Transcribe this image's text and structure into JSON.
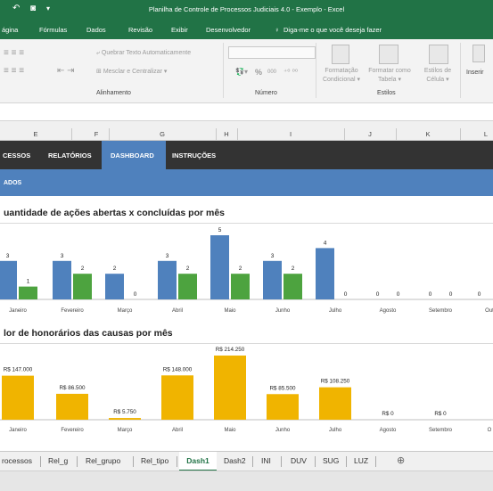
{
  "window": {
    "title": "Planilha de Controle de Processos Judiciais 4.0 - Exemplo  -  Excel"
  },
  "ribbon_tabs": [
    "ágina",
    "Fórmulas",
    "Dados",
    "Revisão",
    "Exibir",
    "Desenvolvedor"
  ],
  "tell_me": "Diga-me o que você deseja fazer",
  "ribbon": {
    "wrap_text": "Quebrar Texto Automaticamente",
    "merge_center": "Mesclar e Centralizar",
    "group_alignment": "Alinhamento",
    "group_number": "Número",
    "group_styles": "Estilos",
    "number_percent": "%",
    "number_thousands": "000",
    "cond_format_1": "Formatação",
    "cond_format_2": "Condicional",
    "format_table_1": "Formatar como",
    "format_table_2": "Tabela",
    "cell_styles_1": "Estilos de",
    "cell_styles_2": "Célula",
    "insert": "Inserir"
  },
  "columns": [
    "E",
    "F",
    "G",
    "H",
    "I",
    "J",
    "K",
    "L"
  ],
  "menu": {
    "items": [
      "CESSOS",
      "RELATÓRIOS",
      "DASHBOARD",
      "INSTRUÇÕES"
    ],
    "active": "DASHBOARD"
  },
  "subheader": "ADOS",
  "chart_data": [
    {
      "type": "bar",
      "title": "uantidade de ações abertas x concluídas por mês",
      "categories": [
        "Janeiro",
        "Fevereiro",
        "Março",
        "Abril",
        "Maio",
        "Junho",
        "Julho",
        "Agosto",
        "Setembro",
        "Out"
      ],
      "series": [
        {
          "color": "#4f81bd",
          "values": [
            3,
            3,
            2,
            3,
            5,
            3,
            4,
            0,
            0,
            0
          ]
        },
        {
          "color": "#4da33f",
          "values": [
            1,
            2,
            0,
            2,
            2,
            2,
            0,
            0,
            0,
            null
          ]
        }
      ],
      "value_labels": [
        [
          "3",
          "3",
          "2",
          "3",
          "5",
          "3",
          "4",
          "0",
          "0",
          "0"
        ],
        [
          "1",
          "2",
          "0",
          "2",
          "2",
          "2",
          "0",
          "0",
          "0",
          ""
        ]
      ],
      "ylim": [
        0,
        5
      ]
    },
    {
      "type": "bar",
      "title": "lor de honorários das causas por mês",
      "categories": [
        "Janeiro",
        "Fevereiro",
        "Março",
        "Abril",
        "Maio",
        "Junho",
        "Julho",
        "Agosto",
        "Setembro",
        "O"
      ],
      "values": [
        147000,
        86500,
        5750,
        148000,
        214250,
        85500,
        108250,
        0,
        0,
        null
      ],
      "value_labels": [
        "R$ 147.000",
        "R$ 86.500",
        "R$ 5.750",
        "R$ 148.000",
        "R$ 214.250",
        "R$ 85.500",
        "R$ 108.250",
        "R$ 0",
        "R$ 0",
        ""
      ],
      "color": "#f0b400",
      "ylim": [
        0,
        214250
      ]
    }
  ],
  "sheet_tabs": [
    "rocessos",
    "Rel_g",
    "Rel_grupo",
    "Rel_tipo",
    "Dash1",
    "Dash2",
    "INI",
    "DUV",
    "SUG",
    "LUZ"
  ],
  "active_sheet": "Dash1",
  "icons": [
    "undo-icon",
    "camera-icon",
    "lightbulb-icon",
    "add-sheet-icon"
  ]
}
